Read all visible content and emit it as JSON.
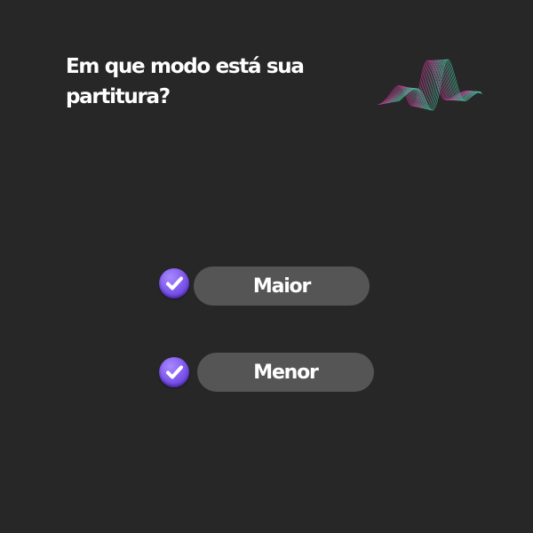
{
  "question": {
    "text": "Em que modo está sua partitura?"
  },
  "logo": {
    "icon": "wave-logo-icon",
    "colors": {
      "pink": "#c0308a",
      "green": "#3fc39a"
    }
  },
  "options": [
    {
      "label": "Maior",
      "icon": "check-icon",
      "selected": true
    },
    {
      "label": "Menor",
      "icon": "check-icon",
      "selected": true
    }
  ],
  "colors": {
    "background": "#272727",
    "pill": "#555555",
    "accent": "#7c55ec",
    "text": "#ffffff"
  }
}
